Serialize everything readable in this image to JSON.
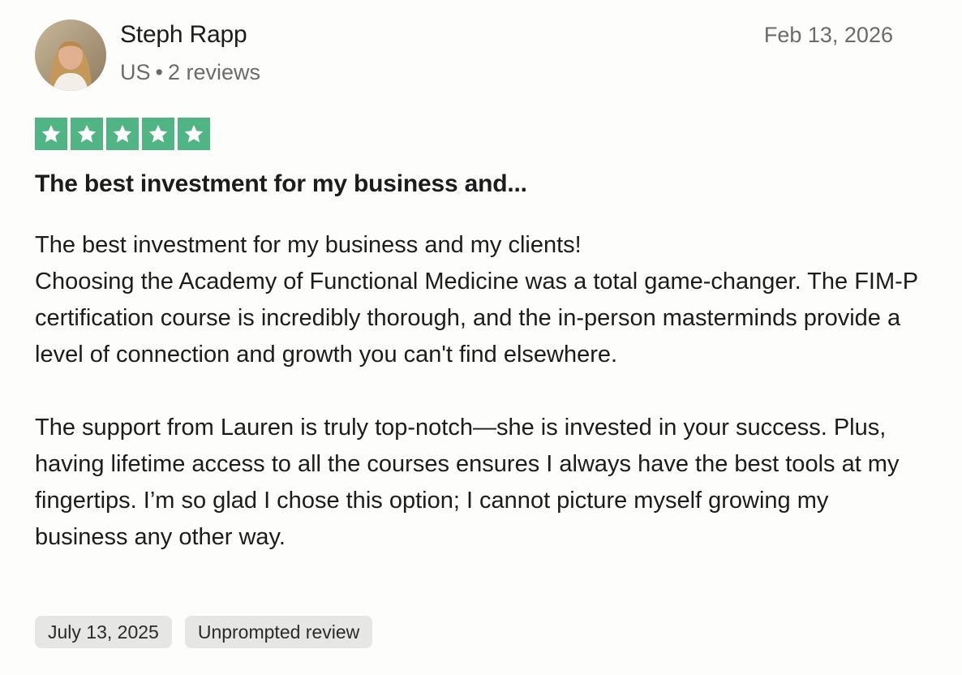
{
  "reviewer": {
    "name": "Steph Rapp",
    "country": "US",
    "separator": "•",
    "review_count": "2 reviews"
  },
  "review": {
    "date": "Feb 13, 2026",
    "rating": 5,
    "rating_color": "#51b485",
    "title": "The best investment for my business and...",
    "body_lines": [
      "The best investment for my business and my clients!",
      "Choosing the Academy of Functional Medicine was a total game-changer. The FIM-P certification course is incredibly thorough, and the in-person masterminds provide a level of connection and growth you can't find elsewhere."
    ],
    "body_paragraph2": "The support from Lauren is truly top-notch—she is invested in your success. Plus, having lifetime access to all the courses ensures I always have the best tools at my fingertips. I’m so glad I chose this option; I cannot picture myself growing my business any other way."
  },
  "tags": {
    "experience_date": "July 13, 2025",
    "review_type": "Unprompted review"
  }
}
